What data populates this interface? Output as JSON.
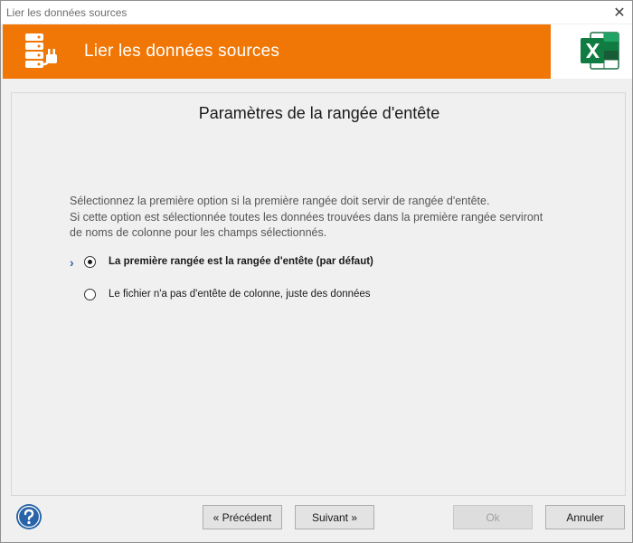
{
  "window": {
    "title": "Lier les données sources"
  },
  "header": {
    "title": "Lier les données sources",
    "accent_color": "#f07706",
    "left_icon": "database-plug-icon",
    "right_icon": "excel-icon"
  },
  "panel": {
    "title": "Paramètres de la rangée d'entête",
    "description_lines": [
      "Sélectionnez la première option si la première rangée doit servir de rangée d'entête.",
      "Si cette option est sélectionnée toutes les données trouvées dans la première rangée serviront",
      "de noms de colonne pour les champs sélectionnés."
    ],
    "options": [
      {
        "label": "La première rangée est la rangée d'entête (par défaut)",
        "selected": true
      },
      {
        "label": "Le fichier n'a pas d'entête de colonne, juste des données",
        "selected": false
      }
    ]
  },
  "footer": {
    "prev_label": "« Précédent",
    "next_label": "Suivant »",
    "ok_label": "Ok",
    "cancel_label": "Annuler"
  }
}
